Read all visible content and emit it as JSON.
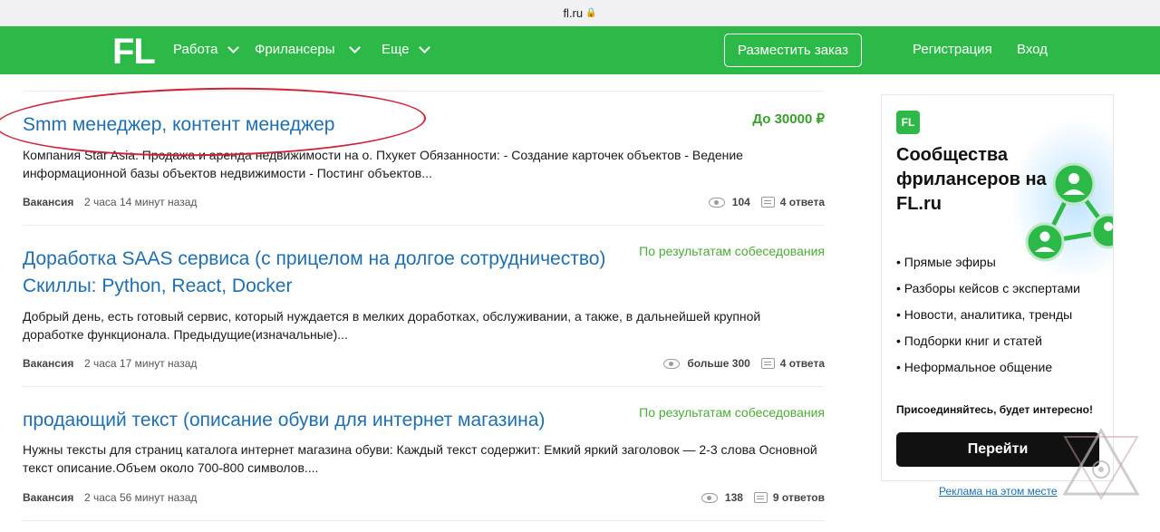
{
  "browser": {
    "url": "fl.ru"
  },
  "nav": {
    "logo": "FL",
    "items": [
      "Работа",
      "Фрилансеры",
      "Еще"
    ],
    "post_order": "Разместить заказ",
    "register": "Регистрация",
    "login": "Вход"
  },
  "jobs": [
    {
      "title": "Smm менеджер, контент менеджер",
      "price": "До 30000 ₽",
      "description": "Компания Star Asia. Продажа и аренда недвижимости на о. Пхукет Обязанности: - Создание карточек объектов - Ведение информационной базы объектов недвижимости - Постинг объектов...",
      "type": "Вакансия",
      "time": "2 часа 14 минут назад",
      "views": "104",
      "answers": "4 ответа"
    },
    {
      "title": "Доработка SAAS сервиса (с прицелом на долгое сотрудничество) Скиллы: Python, React, Docker",
      "price": "По результатам собеседования",
      "description": "Добрый день, есть готовый сервис, который нуждается в мелких доработках, обслуживании, а также, в дальнейшей крупной доработке функционала. Предыдущие(изначальные)...",
      "type": "Вакансия",
      "time": "2 часа 17 минут назад",
      "views": "больше 300",
      "answers": "4 ответа"
    },
    {
      "title": "продающий текст (описание обуви для интернет магазина)",
      "price": "По результатам собеседования",
      "description": "Нужны тексты для страниц каталога интернет магазина обуви: Каждый текст содержит: Емкий яркий заголовок — 2-3 слова Основной текст описание.Объем около 700-800 символов....",
      "type": "Вакансия",
      "time": "2 часа 56 минут назад",
      "views": "138",
      "answers": "9 ответов"
    }
  ],
  "ad": {
    "logo": "FL",
    "title": "Сообщества фрилансеров на FL.ru",
    "bullets": [
      "Прямые эфиры",
      "Разборы кейсов с экспертами",
      "Новости, аналитика, тренды",
      "Подборки книг и статей",
      "Неформальное общение"
    ],
    "cta_text": "Присоединяйтесь, будет интересно!",
    "button": "Перейти",
    "link": "Реклама на этом месте"
  },
  "colors": {
    "brand_green": "#2db948",
    "link_blue": "#1f6fb0",
    "price_green": "#3a9e2e",
    "highlight_red": "#d0213a"
  }
}
